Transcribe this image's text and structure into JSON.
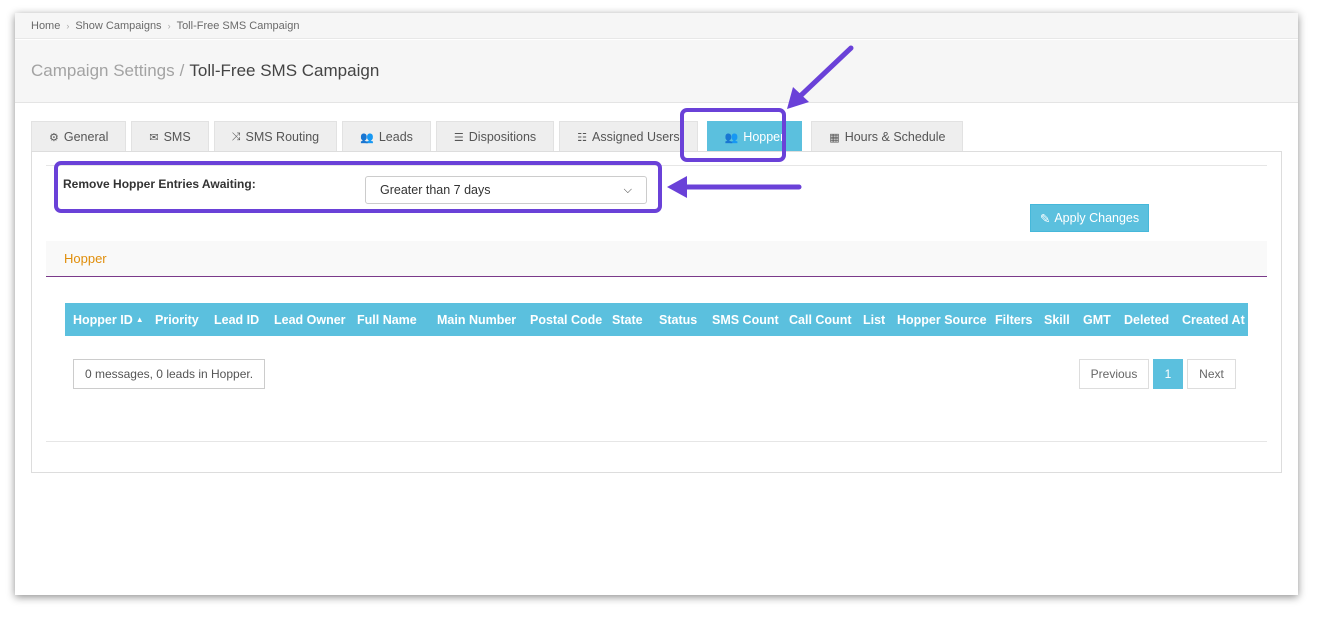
{
  "breadcrumb": [
    "Home",
    "Show Campaigns",
    "Toll-Free SMS Campaign"
  ],
  "header": {
    "section": "Campaign Settings",
    "separator": "/",
    "campaign": "Toll-Free SMS Campaign"
  },
  "tabs": [
    {
      "label": "General",
      "icon": "gears-icon",
      "glyph": "⚙"
    },
    {
      "label": "SMS",
      "icon": "envelope-icon",
      "glyph": "✉"
    },
    {
      "label": "SMS Routing",
      "icon": "shuffle-icon",
      "glyph": "⤨"
    },
    {
      "label": "Leads",
      "icon": "users-icon",
      "glyph": "👥"
    },
    {
      "label": "Dispositions",
      "icon": "list-icon",
      "glyph": "☰"
    },
    {
      "label": "Assigned Users",
      "icon": "ordered-list-icon",
      "glyph": "☷"
    },
    {
      "label": "Hopper",
      "icon": "users-icon",
      "glyph": "👥",
      "active": true
    },
    {
      "label": "Hours & Schedule",
      "icon": "calendar-icon",
      "glyph": "▦"
    }
  ],
  "hopper_settings": {
    "remove_label": "Remove Hopper Entries Awaiting:",
    "selected_option": "Greater than 7 days",
    "apply_label": "Apply Changes",
    "apply_icon": "edit-icon"
  },
  "section_title": "Hopper",
  "table": {
    "columns": [
      "Hopper ID",
      "Priority",
      "Lead ID",
      "Lead Owner",
      "Full Name",
      "Main Number",
      "Postal Code",
      "State",
      "Status",
      "SMS Count",
      "Call Count",
      "List",
      "Hopper Source",
      "Filters",
      "Skill",
      "GMT",
      "Deleted",
      "Created At"
    ],
    "sorted_column": "Hopper ID",
    "sort_indicator": "▲"
  },
  "info_text": "0 messages, 0 leads in Hopper.",
  "pagination": {
    "previous": "Previous",
    "page": "1",
    "next": "Next"
  },
  "colors": {
    "accent": "#5bc0de",
    "highlight": "#6a41d8",
    "section_title": "#e08e0b"
  }
}
